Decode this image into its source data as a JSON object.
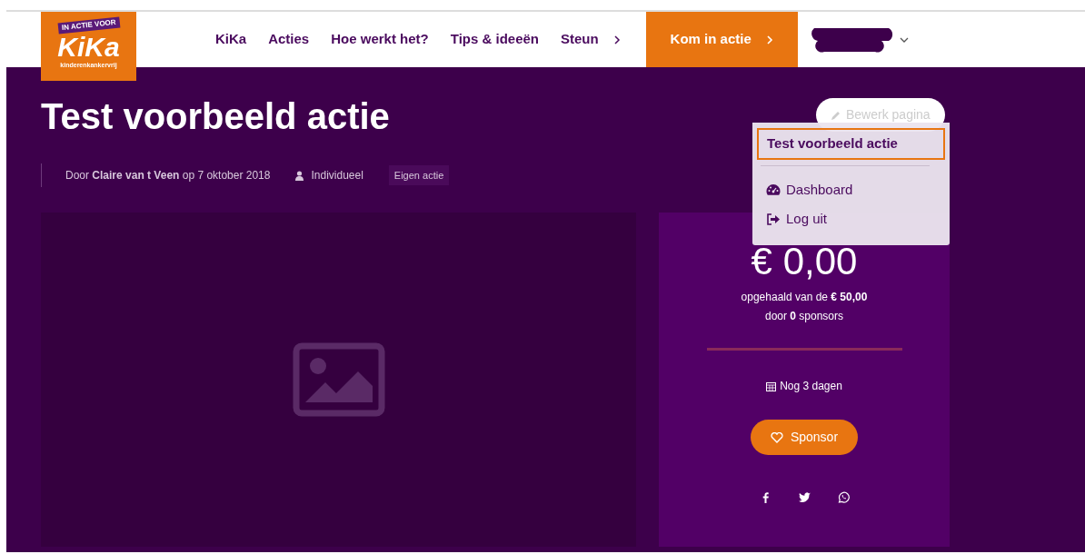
{
  "logo": {
    "tagline": "IN ACTIE VOOR",
    "name": "KiKa",
    "subline": "kinderenkankervrij"
  },
  "nav": [
    {
      "label": "KiKa",
      "submenu": false
    },
    {
      "label": "Acties",
      "submenu": false
    },
    {
      "label": "Hoe werkt het?",
      "submenu": false
    },
    {
      "label": "Tips & ideeën",
      "submenu": false
    },
    {
      "label": "Steun",
      "submenu": true
    }
  ],
  "cta": {
    "label": "Kom in actie"
  },
  "user_menu": {
    "expanded": true,
    "items": [
      {
        "kind": "title",
        "label": "Test voorbeeld actie",
        "selected": true
      },
      {
        "kind": "dashboard",
        "label": "Dashboard",
        "selected": false
      },
      {
        "kind": "logout",
        "label": "Log uit",
        "selected": false
      }
    ]
  },
  "edit_button": {
    "label": "Bewerk pagina"
  },
  "title": "Test voorbeeld actie",
  "meta": {
    "byline": "Door **Claire van t Veen** op 7 oktober 2018",
    "type": "Individueel",
    "tag": "Eigen actie"
  },
  "donation": {
    "amount": "€ 0,00",
    "goal": "opgehaald van de **€ 50,00**",
    "sponsors": "door **0** sponsors",
    "level": 0,
    "remaining": "Nog 3 dagen",
    "button": "Sponsor"
  }
}
